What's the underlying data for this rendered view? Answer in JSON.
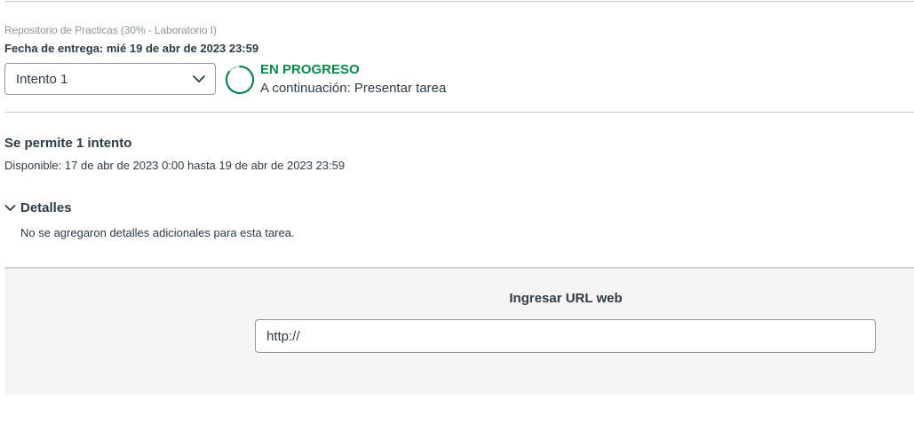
{
  "assignment": {
    "course_title": "Repositorio de Practicas (30% - Laboratorio I)",
    "due_date": "Fecha de entrega: mié 19 de abr de 2023 23:59"
  },
  "attempt_selector": {
    "selected": "Intento 1",
    "icon": "chevron-down-icon"
  },
  "status": {
    "label": "EN PROGRESO",
    "next_step": "A continuación: Presentar tarea",
    "color": "#0b874b",
    "icon": "progress-ring-icon"
  },
  "attempts": {
    "allowed": "Se permite 1 intento",
    "availability": "Disponible: 17 de abr de 2023 0:00 hasta 19 de abr de 2023 23:59"
  },
  "details": {
    "toggle_label": "Detalles",
    "text": "No se agregaron detalles adicionales para esta tarea.",
    "icon": "chevron-down-icon"
  },
  "submission": {
    "heading": "Ingresar URL web",
    "url_value": "http://"
  }
}
